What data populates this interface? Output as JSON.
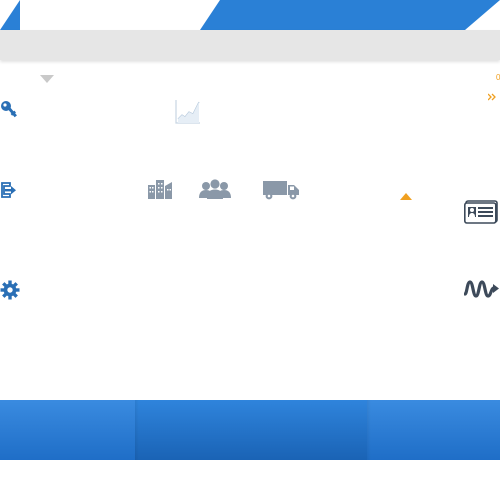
{
  "header": {
    "accent_color": "#2a80d6",
    "subbar_color": "#e6e6e6"
  },
  "left_menu": [
    {
      "icon": "key-icon"
    },
    {
      "icon": "sign-in-icon"
    },
    {
      "icon": "gear-icon"
    }
  ],
  "center_icons": [
    {
      "icon": "chart-icon"
    },
    {
      "icon": "buildings-icon"
    },
    {
      "icon": "people-icon"
    },
    {
      "icon": "truck-icon"
    }
  ],
  "right_icons": [
    {
      "icon": "id-card-icon"
    },
    {
      "icon": "signal-wave-icon"
    }
  ],
  "corner_labels": {
    "top_right_value": "0"
  },
  "colors": {
    "icon_blue": "#2a6fb5",
    "icon_gray": "#8a98a8",
    "accent_orange": "#f0a020"
  }
}
